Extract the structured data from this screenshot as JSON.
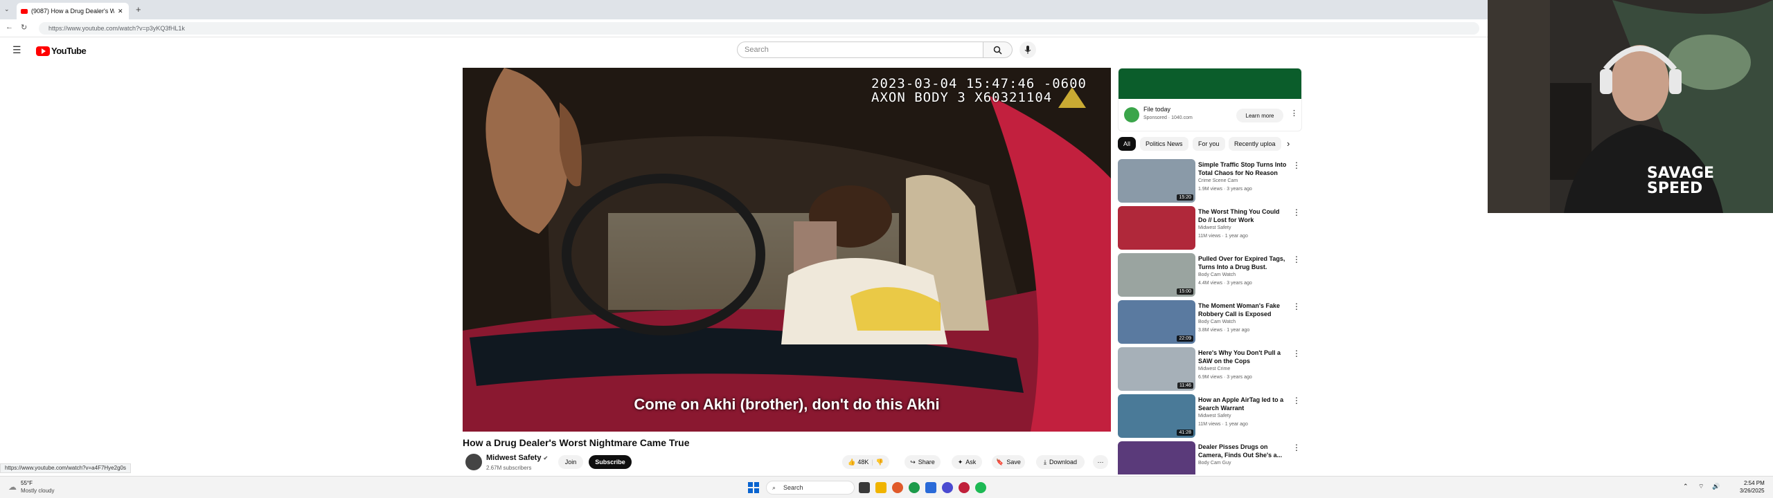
{
  "browser": {
    "tab_title": "(9087) How a Drug Dealer's Wo",
    "url": "https://www.youtube.com/watch?v=p3yKQ3fHL1k",
    "status_url": "https://www.youtube.com/watch?v=a4F7Hye2g0s"
  },
  "header": {
    "logo_text": "YouTube",
    "search_placeholder": "Search"
  },
  "video": {
    "timestamp_line1": "2023-03-04 15:47:46 -0600",
    "timestamp_line2": "AXON BODY 3 X60321104",
    "caption": "Come on Akhi (brother), don't do this Akhi",
    "title": "How a Drug Dealer's Worst Nightmare Came True",
    "channel": "Midwest Safety",
    "subscribers": "2.67M subscribers",
    "join_label": "Join",
    "subscribe_label": "Subscribe",
    "likes": "48K",
    "share_label": "Share",
    "ask_label": "Ask",
    "save_label": "Save",
    "download_label": "Download"
  },
  "ad": {
    "title": "File today",
    "sponsor": "Sponsored · 1040.com",
    "cta": "Learn more"
  },
  "chips": [
    "All",
    "Politics News",
    "For you",
    "Recently uploa"
  ],
  "recommendations": [
    {
      "title": "Simple Traffic Stop Turns Into Total Chaos for No Reason",
      "channel": "Crime Scene Cam",
      "meta": "1.9M views · 3 years ago",
      "duration": "15:20",
      "thumb": "#8a9aa8"
    },
    {
      "title": "The Worst Thing You Could Do // Lost for Work",
      "channel": "Midwest Safety",
      "meta": "11M views · 1 year ago",
      "duration": "",
      "thumb": "#b0283a"
    },
    {
      "title": "Pulled Over for Expired Tags, Turns Into a Drug Bust.",
      "channel": "Body Cam Watch",
      "meta": "4.4M views · 3 years ago",
      "duration": "15:00",
      "thumb": "#9aa4a0"
    },
    {
      "title": "The Moment Woman's Fake Robbery Call is Exposed",
      "channel": "Body Cam Watch",
      "meta": "3.8M views · 1 year ago",
      "duration": "22:09",
      "thumb": "#5a7aa0"
    },
    {
      "title": "Here's Why You Don't Pull a SAW on the Cops",
      "channel": "Midwest Crime",
      "meta": "6.9M views · 3 years ago",
      "duration": "11:46",
      "thumb": "#a6b0b8"
    },
    {
      "title": "How an Apple AirTag led to a Search Warrant",
      "channel": "Midwest Safety",
      "meta": "11M views · 1 year ago",
      "duration": "41:28",
      "thumb": "#4a7a98"
    },
    {
      "title": "Dealer Pisses Drugs on Camera, Finds Out She's a...",
      "channel": "Body Cam Guy",
      "meta": "",
      "duration": "",
      "thumb": "#5a3a7a"
    }
  ],
  "webcam": {
    "shirt_text_1": "SAVAGE",
    "shirt_text_2": "SPEED"
  },
  "taskbar": {
    "weather_temp": "55°F",
    "weather_desc": "Mostly cloudy",
    "search_label": "Search",
    "time": "2:54 PM",
    "date": "3/26/2025"
  }
}
